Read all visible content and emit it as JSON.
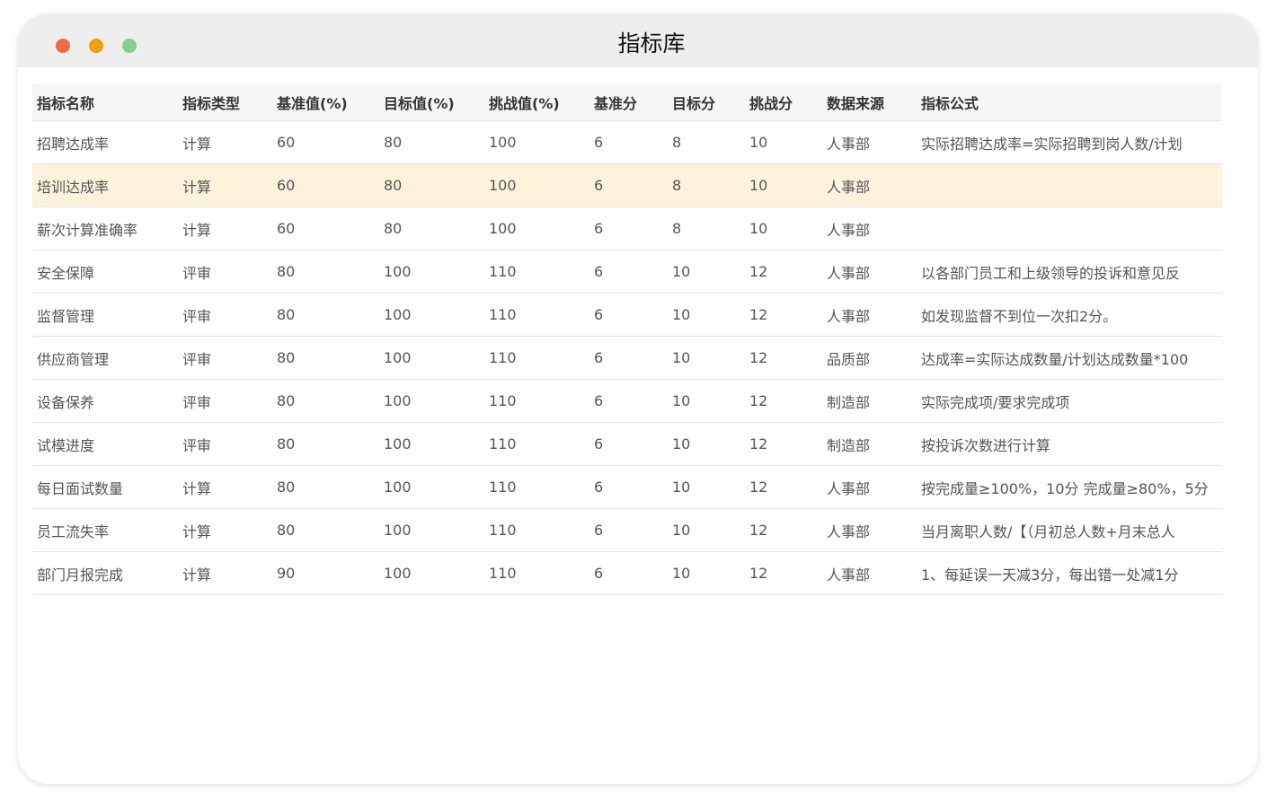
{
  "window": {
    "title": "指标库"
  },
  "table": {
    "columns": [
      "指标名称",
      "指标类型",
      "基准值(%)",
      "目标值(%)",
      "挑战值(%)",
      "基准分",
      "目标分",
      "挑战分",
      "数据来源",
      "指标公式"
    ],
    "rows": [
      [
        "招聘达成率",
        "计算",
        "60",
        "80",
        "100",
        "6",
        "8",
        "10",
        "人事部",
        "实际招聘达成率=实际招聘到岗人数/计划"
      ],
      [
        "培训达成率",
        "计算",
        "60",
        "80",
        "100",
        "6",
        "8",
        "10",
        "人事部",
        ""
      ],
      [
        "薪次计算准确率",
        "计算",
        "60",
        "80",
        "100",
        "6",
        "8",
        "10",
        "人事部",
        ""
      ],
      [
        "安全保障",
        "评审",
        "80",
        "100",
        "110",
        "6",
        "10",
        "12",
        "人事部",
        "以各部门员工和上级领导的投诉和意见反"
      ],
      [
        "监督管理",
        "评审",
        "80",
        "100",
        "110",
        "6",
        "10",
        "12",
        "人事部",
        "如发现监督不到位一次扣2分。"
      ],
      [
        "供应商管理",
        "评审",
        "80",
        "100",
        "110",
        "6",
        "10",
        "12",
        "品质部",
        "达成率=实际达成数量/计划达成数量*100"
      ],
      [
        "设备保养",
        "评审",
        "80",
        "100",
        "110",
        "6",
        "10",
        "12",
        "制造部",
        "实际完成项/要求完成项"
      ],
      [
        "试模进度",
        "评审",
        "80",
        "100",
        "110",
        "6",
        "10",
        "12",
        "制造部",
        "按投诉次数进行计算"
      ],
      [
        "每日面试数量",
        "计算",
        "80",
        "100",
        "110",
        "6",
        "10",
        "12",
        "人事部",
        "按完成量≥100%，10分 完成量≥80%，5分"
      ],
      [
        "员工流失率",
        "计算",
        "80",
        "100",
        "110",
        "6",
        "10",
        "12",
        "人事部",
        "当月离职人数/【（月初总人数+月末总人"
      ],
      [
        "部门月报完成",
        "计算",
        "90",
        "100",
        "110",
        "6",
        "10",
        "12",
        "人事部",
        "1、每延误一天减3分，每出错一处减1分"
      ]
    ],
    "highlighted_row": 1,
    "highlight_color": "#fff2dd"
  }
}
